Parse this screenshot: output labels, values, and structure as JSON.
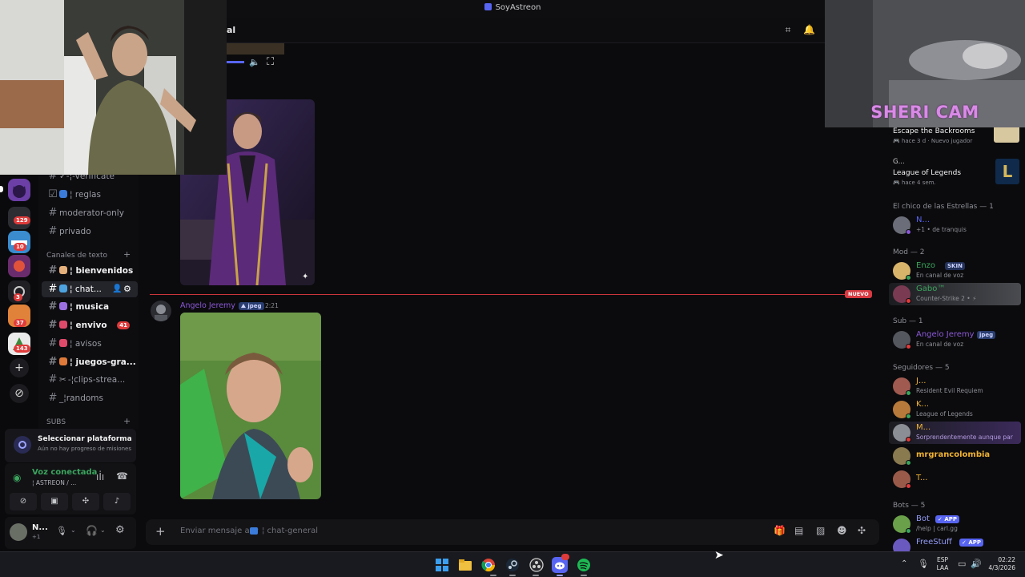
{
  "window": {
    "title": "SoyAstreon"
  },
  "header": {
    "channel_name_fragment": "al"
  },
  "servers": [
    {
      "badge": ""
    },
    {
      "badge": "129"
    },
    {
      "badge": "10"
    },
    {
      "badge": ""
    },
    {
      "badge": "3"
    },
    {
      "badge": "37"
    },
    {
      "badge": "143"
    }
  ],
  "channels": {
    "top": [
      {
        "label": "✓-¦-verificate"
      },
      {
        "label": "¦ reglas"
      },
      {
        "label": "moderator-only"
      },
      {
        "label": "privado"
      }
    ],
    "category_text": "Canales de texto",
    "text": [
      {
        "label": "¦ bienvenidos"
      },
      {
        "label": "¦ chat..."
      },
      {
        "label": "¦ musica"
      },
      {
        "label": "¦ envivo",
        "count": "41"
      },
      {
        "label": "¦ avisos"
      },
      {
        "label": "¦ juegos-gra..."
      },
      {
        "label": "-¦clips-strea..."
      },
      {
        "label": "_¦randoms"
      }
    ],
    "category_subs": "SUBS"
  },
  "mission": {
    "title": "Seleccionar plataforma",
    "subtitle": "Aún no hay progreso de misiones"
  },
  "voice": {
    "status": "Voz conectada",
    "channel": "¦ ASTREON / ..."
  },
  "user": {
    "name": "N...",
    "sub": "+1"
  },
  "messages": [
    {
      "author": "Angelo Jeremy",
      "badge": "jpeg",
      "time": "2:21"
    }
  ],
  "new_marker": "NUEVO",
  "composer": {
    "placeholder": "Enviar mensaje a #",
    "channel": "¦ chat-general"
  },
  "members": {
    "activities": [
      {
        "title": "Escape the Backrooms",
        "meta": "hace 3 d",
        "meta2": "Nuevo jugador"
      },
      {
        "name": "G...",
        "title": "League of Legends",
        "meta": "hace 4 sem."
      }
    ],
    "groups": [
      {
        "label": "El chico de las Estrellas — 1",
        "items": [
          {
            "name": "N...",
            "status": "+1 • de tranquis",
            "color": "#5865f2"
          }
        ]
      },
      {
        "label": "Mod — 2",
        "items": [
          {
            "name": "Enzo",
            "tag": "SKIN",
            "status": "En canal de voz",
            "color": "#3ba55d"
          },
          {
            "name": "Gabo™",
            "status": "Counter-Strike 2 • ⚡",
            "color": "#3ba55d"
          }
        ]
      },
      {
        "label": "Sub — 1",
        "items": [
          {
            "name": "Angelo Jeremy",
            "tag": "jpeg",
            "status": "En canal de voz",
            "color": "#8a58d6"
          }
        ]
      },
      {
        "label": "Seguidores — 5",
        "items": [
          {
            "name": "J...",
            "status": "Resident Evil Requiem",
            "color": "#f0b232"
          },
          {
            "name": "K...",
            "status": "League of Legends",
            "color": "#f0b232"
          },
          {
            "name": "M...",
            "status": "Sorprendentemente aunque par",
            "color": "#f0b232"
          },
          {
            "name": "mrgrancolombia",
            "status": "",
            "color": "#f0b232"
          },
          {
            "name": "T...",
            "status": "",
            "color": "#f0b232"
          }
        ]
      },
      {
        "label": "Bots — 5",
        "items": [
          {
            "name": "Bot",
            "tag": "APP",
            "status": "/help | carl.gg",
            "color": "#949cf7"
          },
          {
            "name": "FreeStuff",
            "tag": "APP",
            "status": "",
            "color": "#949cf7"
          }
        ]
      }
    ]
  },
  "overlay": {
    "sheri_cam": "SHERI CAM"
  },
  "taskbar": {
    "lang": "ESP",
    "lang2": "LAA",
    "time": "02:22",
    "date": "4/3/2026"
  }
}
